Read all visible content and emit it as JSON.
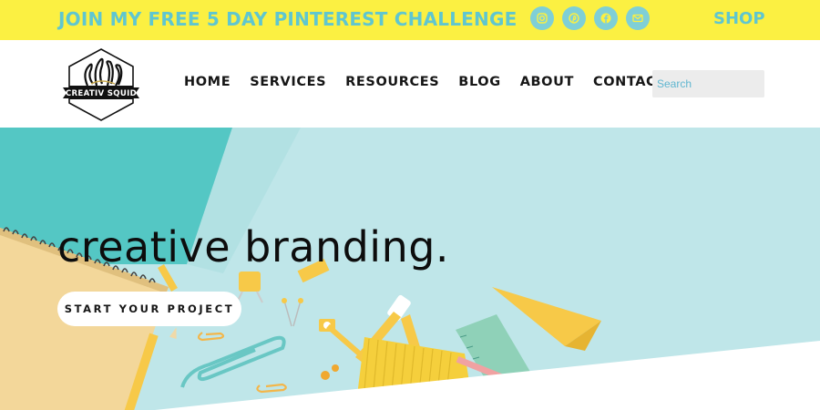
{
  "topbar": {
    "promo": "JOIN MY FREE 5 DAY PINTEREST CHALLENGE",
    "shop": "SHOP",
    "socials": [
      "instagram-icon",
      "pinterest-icon",
      "facebook-icon",
      "email-icon"
    ]
  },
  "header": {
    "logo_text": "CREATIV SQUID",
    "nav": [
      "HOME",
      "SERVICES",
      "RESOURCES",
      "BLOG",
      "ABOUT",
      "CONTACT"
    ],
    "search_placeholder": "Search"
  },
  "hero": {
    "title": "creative branding.",
    "cta": "START YOUR PROJECT"
  },
  "colors": {
    "accent_yellow": "#fbf042",
    "accent_teal": "#5fc6d0",
    "hero_bg": "#bfe6e9"
  }
}
